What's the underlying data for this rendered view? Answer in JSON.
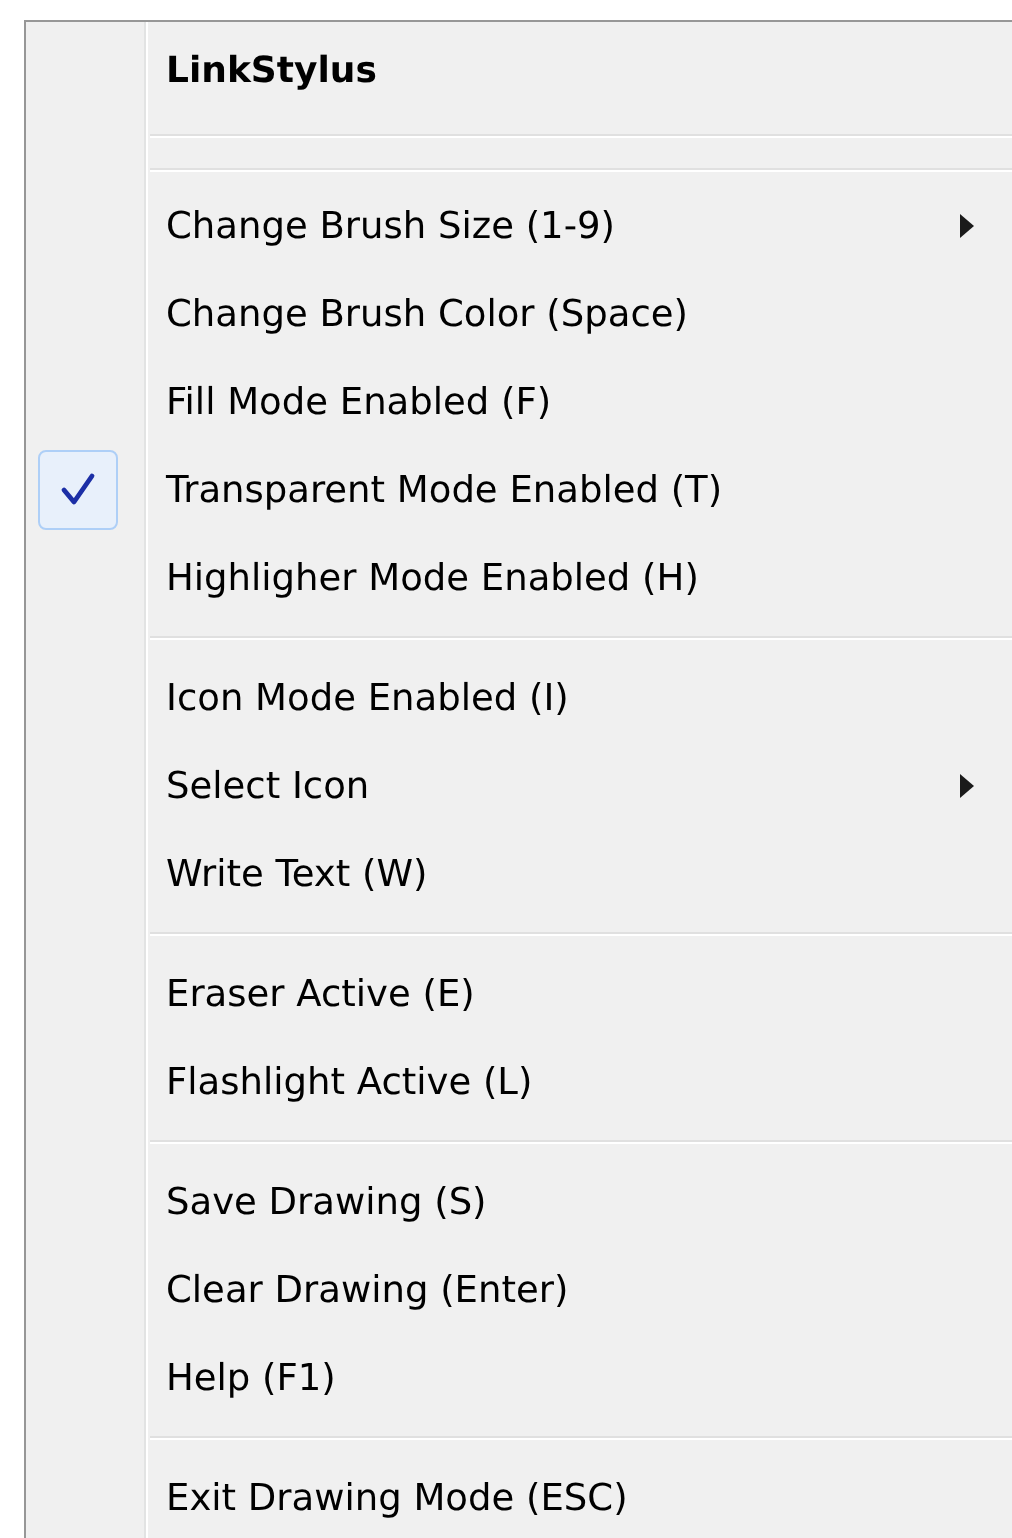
{
  "menu": {
    "title": "LinkStylus",
    "sections": [
      [
        {
          "label": "Change Brush Size (1-9)",
          "checked": false,
          "submenu": true
        },
        {
          "label": "Change Brush Color (Space)",
          "checked": false,
          "submenu": false
        },
        {
          "label": "Fill Mode Enabled (F)",
          "checked": false,
          "submenu": false
        },
        {
          "label": "Transparent Mode Enabled (T)",
          "checked": true,
          "submenu": false
        },
        {
          "label": "Highligher Mode Enabled (H)",
          "checked": false,
          "submenu": false
        }
      ],
      [
        {
          "label": "Icon Mode Enabled (I)",
          "checked": false,
          "submenu": false
        },
        {
          "label": "Select Icon",
          "checked": false,
          "submenu": true
        },
        {
          "label": "Write Text (W)",
          "checked": false,
          "submenu": false
        }
      ],
      [
        {
          "label": "Eraser Active (E)",
          "checked": false,
          "submenu": false
        },
        {
          "label": "Flashlight Active (L)",
          "checked": false,
          "submenu": false
        }
      ],
      [
        {
          "label": "Save Drawing (S)",
          "checked": false,
          "submenu": false
        },
        {
          "label": "Clear Drawing (Enter)",
          "checked": false,
          "submenu": false
        },
        {
          "label": "Help (F1)",
          "checked": false,
          "submenu": false
        }
      ],
      [
        {
          "label": "Exit Drawing Mode (ESC)",
          "checked": false,
          "submenu": false
        }
      ]
    ]
  }
}
